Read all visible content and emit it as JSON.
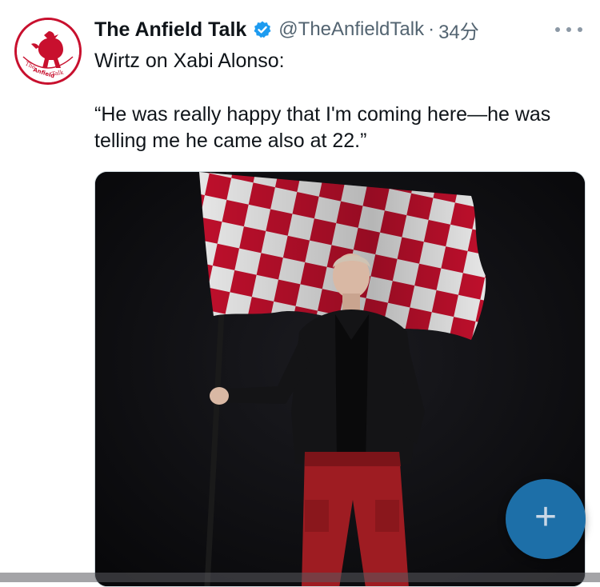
{
  "tweet": {
    "author_name": "The Anfield Talk",
    "handle": "@TheAnfieldTalk",
    "separator": "·",
    "time": "34分",
    "text_line1": "Wirtz on Xabi Alonso:",
    "text_quote": "“He was really happy that I'm coming here—he was telling me he came also at 22.”",
    "verified_icon": "verified-badge-icon",
    "more_icon": "more-options-icon"
  },
  "avatar": {
    "logo_text": "TheAnfield Talk",
    "brand_color": "#c8102e"
  },
  "media": {
    "flag_colors": [
      "#c8102e",
      "#f2f2f2"
    ]
  },
  "fab": {
    "label": "+",
    "icon": "plus-icon",
    "color": "#1d6fa8"
  },
  "colors": {
    "verified": "#1d9bf0",
    "secondary_text": "#536471"
  }
}
